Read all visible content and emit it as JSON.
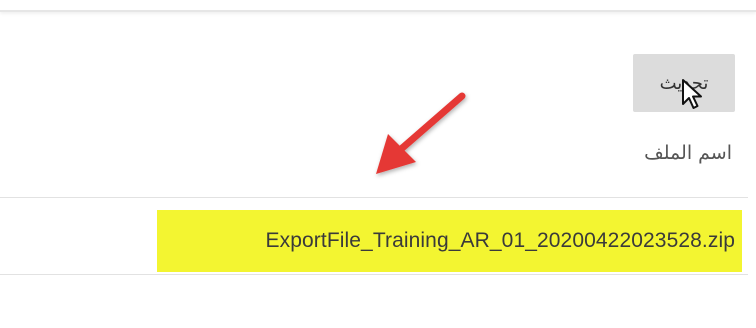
{
  "toolbar": {
    "update_label": "تحديث"
  },
  "table": {
    "column_header": "اسم الملف",
    "rows": [
      {
        "file_name": "ExportFile_Training_AR_01_20200422023528.zip"
      }
    ]
  },
  "annotation": {
    "arrow_color": "#e53935",
    "highlight_color": "#f3f531"
  },
  "icons": {
    "cursor": "mouse-pointer-icon",
    "arrow": "annotation-arrow-icon"
  }
}
